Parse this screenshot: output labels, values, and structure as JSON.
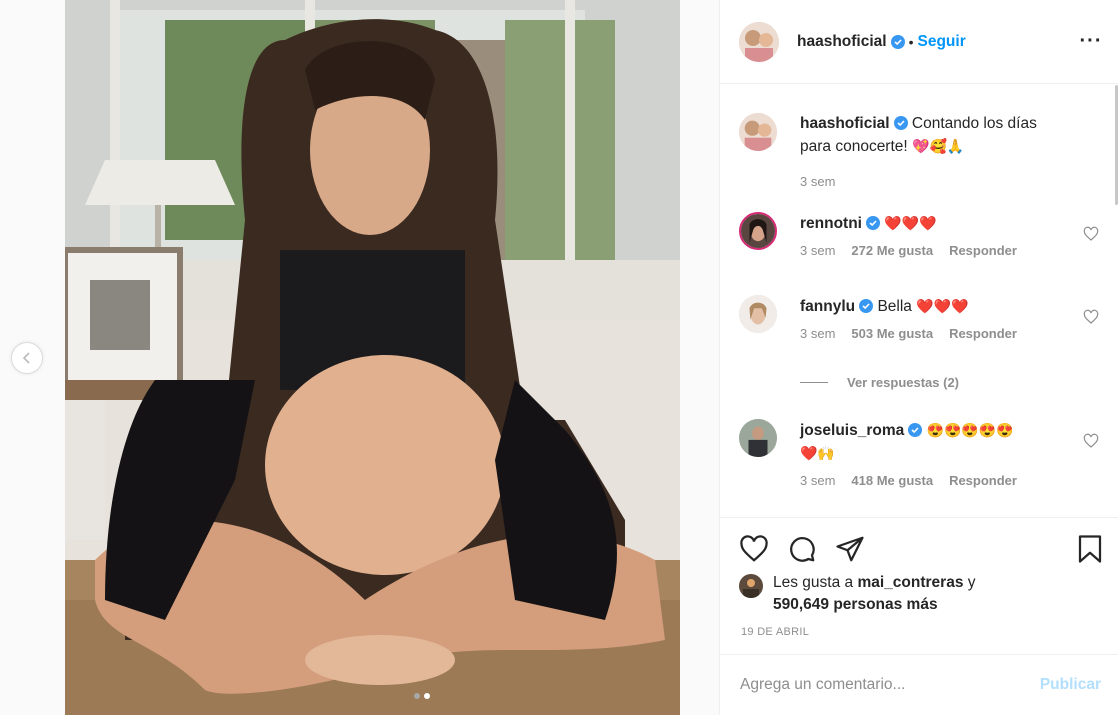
{
  "post": {
    "username": "haashoficial",
    "follow_label": "Seguir",
    "separator": "•",
    "more_label": "···"
  },
  "caption": {
    "username": "haashoficial",
    "line1": "Contando los días",
    "line2": "para conocerte!",
    "emojis": "💖🥰🙏",
    "time": "3 sem"
  },
  "comments": [
    {
      "username": "rennotni",
      "text": "",
      "emojis": "❤️❤️❤️",
      "time": "3 sem",
      "likes": "272 Me gusta",
      "reply": "Responder"
    },
    {
      "username": "fannylu",
      "text": "Bella",
      "emojis": "❤️❤️❤️",
      "time": "3 sem",
      "likes": "503 Me gusta",
      "reply": "Responder"
    },
    {
      "username": "joseluis_roma",
      "text": "",
      "emojis": "😍😍😍😍😍",
      "emojis2": "❤️🙌",
      "time": "3 sem",
      "likes": "418 Me gusta",
      "reply": "Responder"
    }
  ],
  "view_replies": "Ver respuestas (2)",
  "likes": {
    "prefix": "Les gusta a",
    "user": "mai_contreras",
    "suffix": "y",
    "count": "590,649 personas más"
  },
  "date": "19 DE ABRIL",
  "add_comment": {
    "placeholder": "Agrega un comentario...",
    "post_label": "Publicar"
  },
  "colors": {
    "link": "#0095f6",
    "verified": "#3897f0",
    "muted": "#8e8e8e",
    "post_disabled": "#b2dffc"
  },
  "carousel": {
    "count": 2,
    "active": 2
  }
}
